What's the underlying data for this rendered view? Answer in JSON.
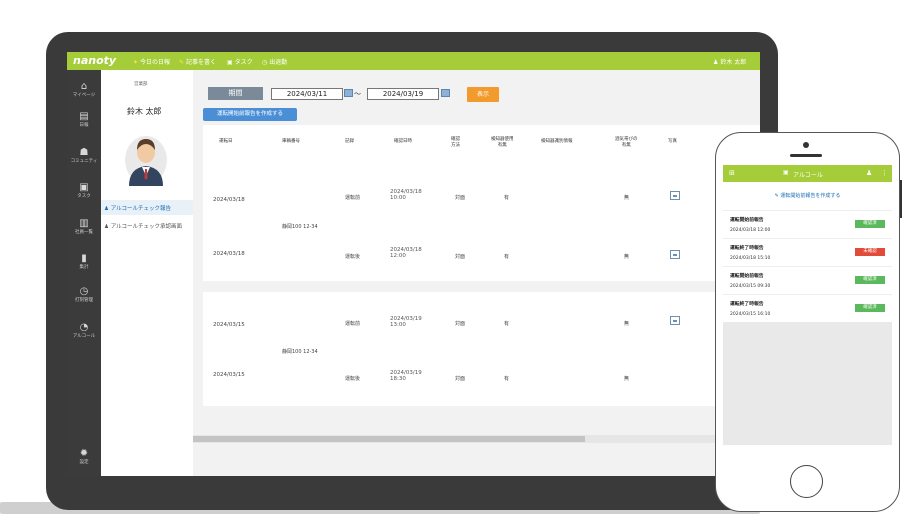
{
  "app": {
    "logo": "nanoty",
    "nav": [
      "今日の日報",
      "記事を書く",
      "タスク",
      "出退勤"
    ],
    "user_menu": "鈴木 太郎"
  },
  "sidebar": {
    "items": [
      "マイページ",
      "日報",
      "コミュニティ",
      "タスク",
      "社員一覧",
      "集計",
      "打刻管理",
      "アルコール",
      "設定"
    ]
  },
  "profile": {
    "department": "営業部",
    "name": "鈴木 太郎",
    "menu": [
      "アルコールチェック報告",
      "アルコールチェック承認画面"
    ]
  },
  "filter": {
    "period_label": "期間",
    "date_from": "2024/03/11",
    "separator": "〜",
    "date_to": "2024/03/19",
    "show_label": "表示",
    "create_label": "運転開始前報告を作成する"
  },
  "table": {
    "headers": [
      "運転日",
      "車輌番号",
      "記録",
      "確認日時",
      "確認\n方法",
      "検知器使用\n有無",
      "検知器識別情報",
      "酒気帯びの\n有無",
      "写真"
    ],
    "groups": [
      {
        "vehicle": "静岡100 12-34",
        "rows": [
          {
            "date": "2024/03/18",
            "record": "運転前",
            "checked_date": "2024/03/18",
            "checked_time": "10:00",
            "method": "対面",
            "detector": "有",
            "alcohol": "無"
          },
          {
            "date": "2024/03/18",
            "record": "運転後",
            "checked_date": "2024/03/18",
            "checked_time": "12:00",
            "method": "対面",
            "detector": "有",
            "alcohol": "無"
          }
        ]
      },
      {
        "vehicle": "静岡100 12-34",
        "rows": [
          {
            "date": "2024/03/15",
            "record": "運転前",
            "checked_date": "2024/03/19",
            "checked_time": "13:00",
            "method": "対面",
            "detector": "有",
            "alcohol": "無"
          },
          {
            "date": "2024/03/15",
            "record": "運転後",
            "checked_date": "2024/03/19",
            "checked_time": "18:30",
            "method": "対面",
            "detector": "有",
            "alcohol": "無"
          }
        ]
      }
    ]
  },
  "phone": {
    "title": "アルコール",
    "create_label": "運転開始前報告を作成する",
    "items": [
      {
        "title": "運転開始前報告",
        "date": "2024/03/18 12:00",
        "status": "確認済",
        "status_color": "#5cb85c"
      },
      {
        "title": "運転終了時報告",
        "date": "2024/03/18 15:10",
        "status": "未確認",
        "status_color": "#e04b3a"
      },
      {
        "title": "運転開始前報告",
        "date": "2024/03/15 09:30",
        "status": "確認済",
        "status_color": "#5cb85c"
      },
      {
        "title": "運転終了時報告",
        "date": "2024/03/15 16:10",
        "status": "確認済",
        "status_color": "#5cb85c"
      }
    ]
  },
  "colors": {
    "brand": "#a5cd39",
    "accent_orange": "#f39a2c",
    "link_blue": "#4a8fd6",
    "sidebar": "#3b3b3b"
  }
}
